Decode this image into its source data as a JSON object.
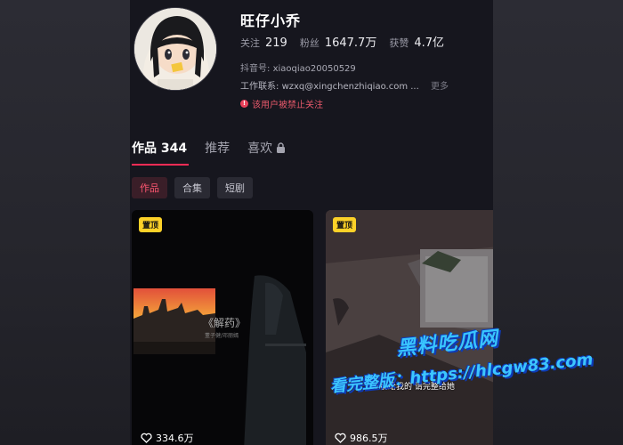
{
  "profile": {
    "nickname": "旺仔小乔",
    "following_label": "关注",
    "following_value": "219",
    "followers_label": "粉丝",
    "followers_value": "1647.7万",
    "likes_label": "获赞",
    "likes_value": "4.7亿",
    "douyin_id_label": "抖音号:",
    "douyin_id_value": "xiaoqiao20050529",
    "contact_label": "工作联系:",
    "contact_value": "wzxq@xingchenzhiqiao.com ...",
    "more_label": "更多",
    "ban_notice": "该用户被禁止关注"
  },
  "tabs": [
    {
      "label": "作品 344",
      "active": true
    },
    {
      "label": "推荐",
      "active": false
    },
    {
      "label": "喜欢",
      "active": false,
      "icon": "lock-icon"
    }
  ],
  "chips": [
    {
      "label": "作品",
      "active": true
    },
    {
      "label": "合集",
      "active": false
    },
    {
      "label": "短剧",
      "active": false
    }
  ],
  "videos": [
    {
      "pin_label": "置顶",
      "likes": "334.6万",
      "title_overlay": "《解药》",
      "credit_overlay": "董子健/邓丽嫣"
    },
    {
      "pin_label": "置顶",
      "likes": "986.5万",
      "subtitle": "不能给我的 请完整给她"
    }
  ],
  "watermark": {
    "line1": "黑料吃瓜网",
    "line2": "看完整版：https://hlcgw83.com"
  },
  "colors": {
    "accent": "#fe2c55",
    "pin": "#fcd128",
    "ban": "#e8596b",
    "watermark": "#39c4ff"
  }
}
